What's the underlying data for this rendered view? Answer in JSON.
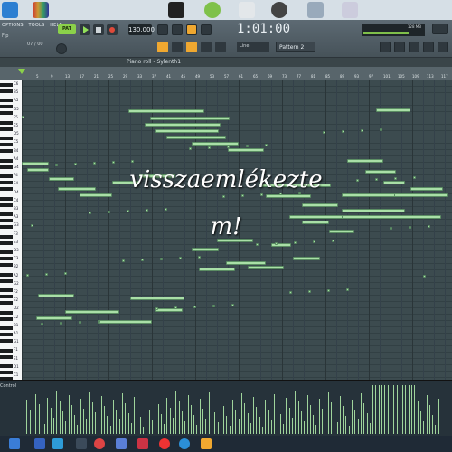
{
  "toolbar": {
    "menu": [
      "OPTIONS",
      "TOOLS",
      "HELP"
    ],
    "pattern_mode": "PAT",
    "tempo": "130.000",
    "time": "1:01:00",
    "line_mode": "Line",
    "pattern": "Pattern 2",
    "cpu_text": "128 MB",
    "left_readout": "Flp",
    "left_readout2": "07 / 00"
  },
  "piano_roll": {
    "title": "Piano roll - Sylenth1",
    "ruler_numbers": [
      "5",
      "9",
      "13",
      "17",
      "21",
      "25",
      "29",
      "33",
      "37",
      "41",
      "45",
      "49",
      "53",
      "57",
      "61",
      "65",
      "69",
      "73",
      "77",
      "81",
      "85",
      "89",
      "93",
      "97",
      "101",
      "105",
      "109",
      "113",
      "117"
    ],
    "key_labels": [
      "C6",
      "B5",
      "A5",
      "G5",
      "F5",
      "E5",
      "D5",
      "C5",
      "B4",
      "A4",
      "G4",
      "F4",
      "E4",
      "D4",
      "C4",
      "B3",
      "A3",
      "G3",
      "F3",
      "E3",
      "D3",
      "C3",
      "B2",
      "A2",
      "G2",
      "F2",
      "E2",
      "D2",
      "C2",
      "B1",
      "A1",
      "G1",
      "F1",
      "E1",
      "D1",
      "C1"
    ]
  },
  "overlay": {
    "line1": "visszaemlékezte",
    "line2": "m!"
  },
  "control_pane": {
    "label": "Control"
  },
  "colors": {
    "note_fill": "#a9dfa7",
    "accent_green": "#8bd14a",
    "accent_orange": "#f0a830"
  }
}
